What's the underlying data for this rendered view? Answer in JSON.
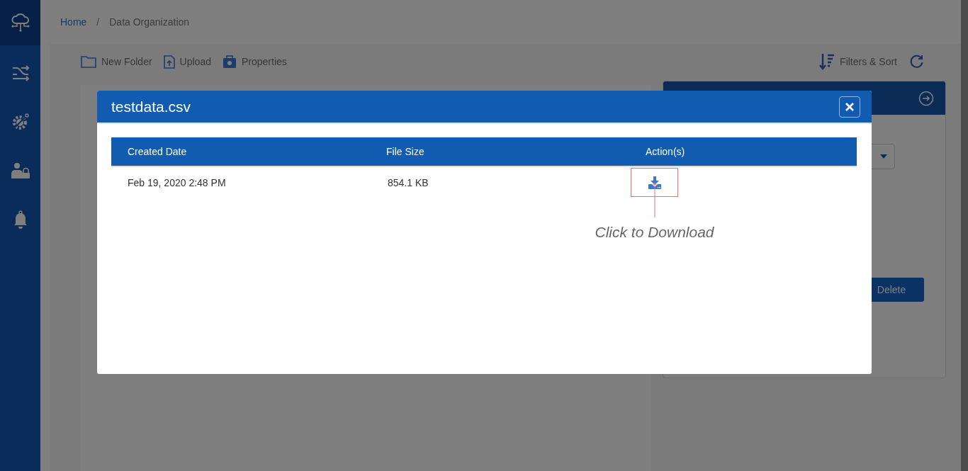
{
  "sidebar": {
    "items": [
      {
        "selected": true
      },
      {
        "selected": false
      },
      {
        "selected": false
      },
      {
        "selected": false
      },
      {
        "selected": false
      }
    ]
  },
  "breadcrumb": [
    "Home",
    "/",
    "Data Organization"
  ],
  "toolbar": {
    "actions": [
      "New Folder",
      "Upload",
      "Properties"
    ],
    "filters_label": "Filters & Sort"
  },
  "side_panel": {
    "action_button": "Delete"
  },
  "modal": {
    "title": "testdata.csv",
    "table": {
      "columns": [
        "Created Date",
        "File Size",
        "Action(s)"
      ],
      "rows": [
        {
          "created": "Feb 19, 2020 2:48 PM",
          "size": "854.1 KB"
        }
      ]
    },
    "annotation": "Click to Download"
  }
}
